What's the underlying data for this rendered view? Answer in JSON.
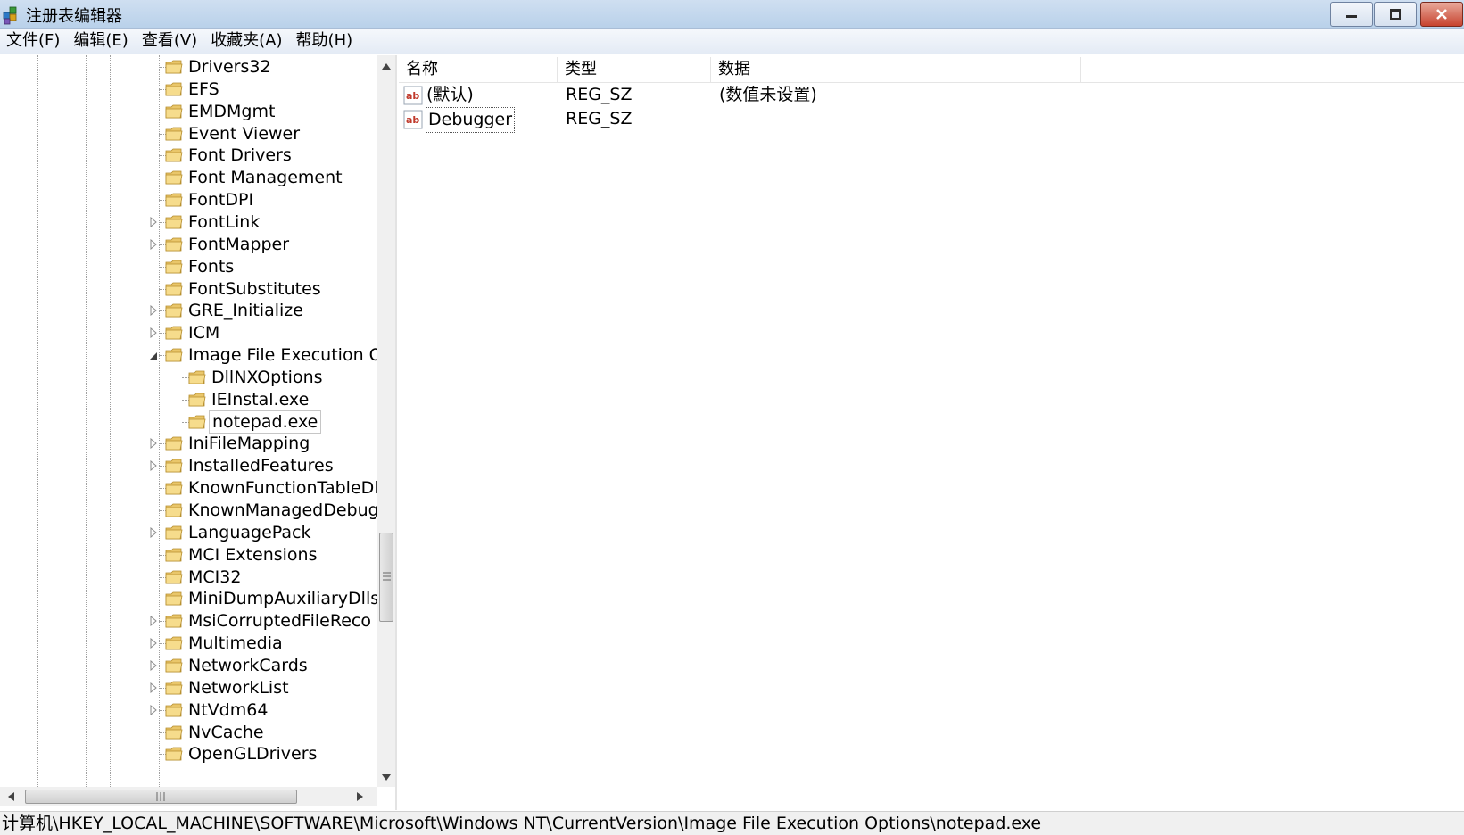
{
  "window": {
    "title": "注册表编辑器",
    "icon": "registry-icon"
  },
  "menu": [
    {
      "label": "文件(F)"
    },
    {
      "label": "编辑(E)"
    },
    {
      "label": "查看(V)"
    },
    {
      "label": "收藏夹(A)"
    },
    {
      "label": "帮助(H)"
    }
  ],
  "tree": {
    "items": [
      {
        "label": "Drivers32",
        "level": 0,
        "expander": "none"
      },
      {
        "label": "EFS",
        "level": 0,
        "expander": "none"
      },
      {
        "label": "EMDMgmt",
        "level": 0,
        "expander": "none"
      },
      {
        "label": "Event Viewer",
        "level": 0,
        "expander": "none"
      },
      {
        "label": "Font Drivers",
        "level": 0,
        "expander": "none"
      },
      {
        "label": "Font Management",
        "level": 0,
        "expander": "none"
      },
      {
        "label": "FontDPI",
        "level": 0,
        "expander": "none"
      },
      {
        "label": "FontLink",
        "level": 0,
        "expander": "collapsed"
      },
      {
        "label": "FontMapper",
        "level": 0,
        "expander": "collapsed"
      },
      {
        "label": "Fonts",
        "level": 0,
        "expander": "none"
      },
      {
        "label": "FontSubstitutes",
        "level": 0,
        "expander": "none"
      },
      {
        "label": "GRE_Initialize",
        "level": 0,
        "expander": "collapsed"
      },
      {
        "label": "ICM",
        "level": 0,
        "expander": "collapsed"
      },
      {
        "label": "Image File Execution O",
        "level": 0,
        "expander": "expanded"
      },
      {
        "label": "DllNXOptions",
        "level": 1,
        "expander": "none"
      },
      {
        "label": "IEInstal.exe",
        "level": 1,
        "expander": "none"
      },
      {
        "label": "notepad.exe",
        "level": 1,
        "expander": "none",
        "selected": true
      },
      {
        "label": "IniFileMapping",
        "level": 0,
        "expander": "collapsed"
      },
      {
        "label": "InstalledFeatures",
        "level": 0,
        "expander": "collapsed"
      },
      {
        "label": "KnownFunctionTableDl",
        "level": 0,
        "expander": "none"
      },
      {
        "label": "KnownManagedDebug",
        "level": 0,
        "expander": "none"
      },
      {
        "label": "LanguagePack",
        "level": 0,
        "expander": "collapsed"
      },
      {
        "label": "MCI Extensions",
        "level": 0,
        "expander": "none"
      },
      {
        "label": "MCI32",
        "level": 0,
        "expander": "none"
      },
      {
        "label": "MiniDumpAuxiliaryDlls",
        "level": 0,
        "expander": "none"
      },
      {
        "label": "MsiCorruptedFileReco",
        "level": 0,
        "expander": "collapsed"
      },
      {
        "label": "Multimedia",
        "level": 0,
        "expander": "collapsed"
      },
      {
        "label": "NetworkCards",
        "level": 0,
        "expander": "collapsed"
      },
      {
        "label": "NetworkList",
        "level": 0,
        "expander": "collapsed"
      },
      {
        "label": "NtVdm64",
        "level": 0,
        "expander": "collapsed"
      },
      {
        "label": "NvCache",
        "level": 0,
        "expander": "none"
      },
      {
        "label": "OpenGLDrivers",
        "level": 0,
        "expander": "none"
      }
    ]
  },
  "list": {
    "columns": [
      {
        "label": "名称"
      },
      {
        "label": "类型"
      },
      {
        "label": "数据"
      }
    ],
    "rows": [
      {
        "name": "(默认)",
        "type": "REG_SZ",
        "data": "(数值未设置)",
        "icon": "string-value-icon"
      },
      {
        "name": "Debugger",
        "type": "REG_SZ",
        "data": "",
        "icon": "string-value-icon",
        "focused": true
      }
    ]
  },
  "status": {
    "path": "计算机\\HKEY_LOCAL_MACHINE\\SOFTWARE\\Microsoft\\Windows NT\\CurrentVersion\\Image File Execution Options\\notepad.exe"
  }
}
